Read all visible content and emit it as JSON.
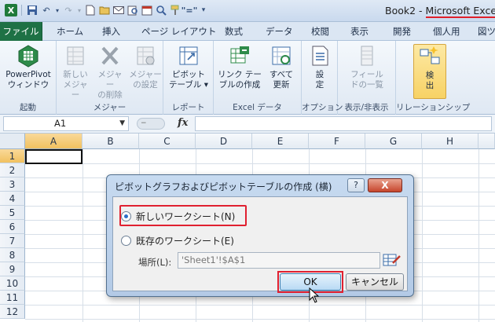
{
  "window": {
    "doc_title": "Book2 - ",
    "app_title": "Microsoft Excel"
  },
  "tabs": [
    {
      "label": "ファイル"
    },
    {
      "label": "ホーム"
    },
    {
      "label": "挿入"
    },
    {
      "label": "ページ レイアウト"
    },
    {
      "label": "数式"
    },
    {
      "label": "データ"
    },
    {
      "label": "校閲"
    },
    {
      "label": "表示"
    },
    {
      "label": "開発"
    },
    {
      "label": "個人用"
    },
    {
      "label": "図ツ"
    }
  ],
  "ribbon": {
    "groups": [
      {
        "label": "起動",
        "buttons": [
          {
            "label1": "PowerPivot",
            "label2": "ウィンドウ",
            "icon": "powerpivot-icon"
          }
        ]
      },
      {
        "label": "メジャー",
        "buttons": [
          {
            "label1": "新しい",
            "label2": "メジャー",
            "icon": "new-measure-icon"
          },
          {
            "label1": "メジャー",
            "label2": "の削除",
            "icon": "delete-measure-icon"
          },
          {
            "label1": "メジャー",
            "label2": "の設定",
            "icon": "measure-settings-icon"
          }
        ]
      },
      {
        "label": "レポート",
        "buttons": [
          {
            "label1": "ピボット",
            "label2": "テーブル ▾",
            "icon": "pivottable-icon"
          }
        ]
      },
      {
        "label": "Excel データ",
        "buttons": [
          {
            "label1": "リンク テー",
            "label2": "ブルの作成",
            "icon": "create-linked-table-icon"
          },
          {
            "label1": "すべて",
            "label2": "更新",
            "icon": "refresh-all-icon"
          }
        ]
      },
      {
        "label": "オプション",
        "buttons": [
          {
            "label1": "設",
            "label2": "定",
            "icon": "settings-icon"
          }
        ]
      },
      {
        "label": "表示/非表示",
        "buttons": [
          {
            "label1": "フィール",
            "label2": "ドの一覧",
            "icon": "field-list-icon"
          }
        ]
      },
      {
        "label": "リレーションシップ",
        "buttons": [
          {
            "label1": "検",
            "label2": "出",
            "icon": "detect-icon"
          }
        ]
      }
    ]
  },
  "formula_bar": {
    "name_box": "A1",
    "fx": "fx",
    "formula": ""
  },
  "grid": {
    "columns": [
      "A",
      "B",
      "C",
      "D",
      "E",
      "F",
      "G",
      "H"
    ],
    "rows": [
      "1",
      "2",
      "3",
      "4",
      "5",
      "6",
      "7",
      "8",
      "9",
      "10",
      "11",
      "12"
    ],
    "active_cell": "A1"
  },
  "dialog": {
    "title": "ピボットグラフおよびピボットテーブルの作成 (横)",
    "help": "?",
    "close": "X",
    "option_new": "新しいワークシート(N)",
    "option_existing": "既存のワークシート(E)",
    "location_label": "場所(L):",
    "location_value": "'Sheet1'!$A$1",
    "ok_label": "OK",
    "cancel_label": "キャンセル"
  }
}
